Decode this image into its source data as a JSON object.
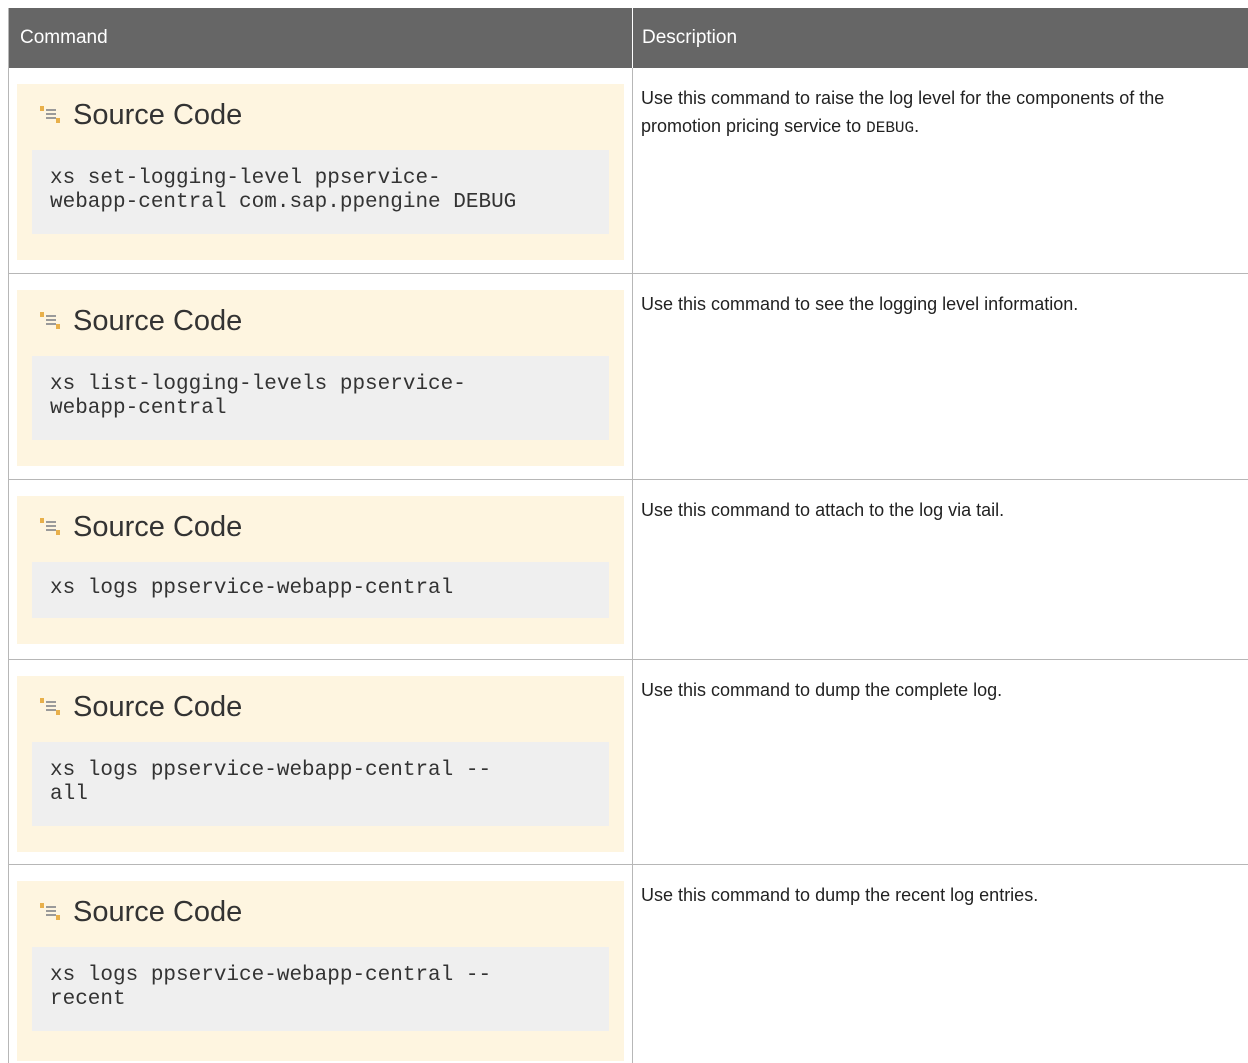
{
  "table": {
    "headers": {
      "command": "Command",
      "description": "Description"
    },
    "rows": [
      {
        "code_title": "Source Code",
        "code": "xs set-logging-level ppservice-\nwebapp-central com.sap.ppengine DEBUG",
        "description_before": "Use this command to raise the log level for the components of the promotion pricing service to ",
        "description_code": "DEBUG",
        "description_after": "."
      },
      {
        "code_title": "Source Code",
        "code": "xs list-logging-levels ppservice-\nwebapp-central",
        "description": "Use this command to see the logging level information."
      },
      {
        "code_title": "Source Code",
        "code": "xs logs ppservice-webapp-central",
        "description": "Use this command to attach to the log via tail."
      },
      {
        "code_title": "Source Code",
        "code": "xs logs ppservice-webapp-central --\nall",
        "description": "Use this command to dump the complete log."
      },
      {
        "code_title": "Source Code",
        "code": "xs logs ppservice-webapp-central --\nrecent",
        "description": "Use this command to dump the recent log entries."
      }
    ]
  },
  "icons": {
    "source_code": "source-code-icon"
  },
  "colors": {
    "header_bg": "#666666",
    "code_box_bg": "#fef5e0",
    "code_area_bg": "#efefef",
    "icon_accent": "#f0b400"
  }
}
